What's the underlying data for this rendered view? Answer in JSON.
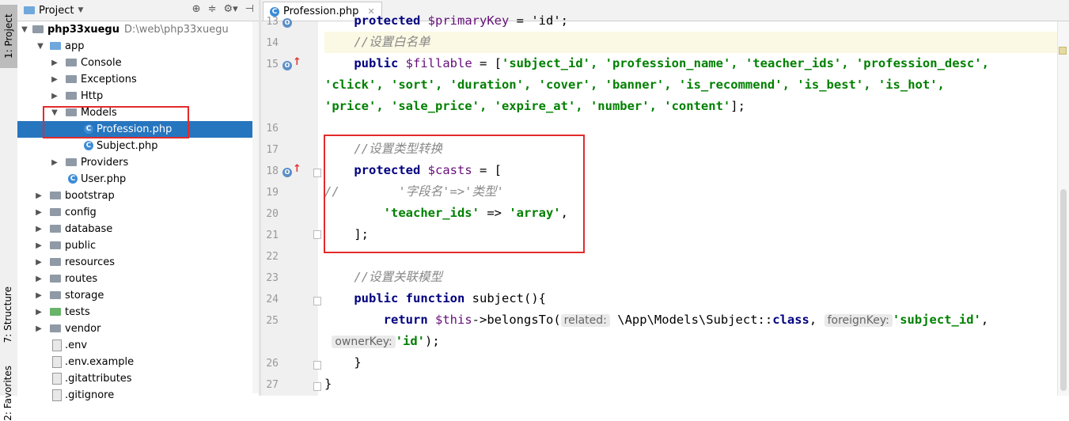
{
  "toolstrip": {
    "project_tab": "1: Project",
    "structure_tab": "7: Structure",
    "favorites_tab": "2: Favorites"
  },
  "project_panel": {
    "title": "Project",
    "root": {
      "name": "php33xuegu",
      "path": "D:\\web\\php33xuegu"
    },
    "tree": [
      {
        "label": "app"
      },
      {
        "label": "Console"
      },
      {
        "label": "Exceptions"
      },
      {
        "label": "Http"
      },
      {
        "label": "Models"
      },
      {
        "label": "Profession.php"
      },
      {
        "label": "Subject.php"
      },
      {
        "label": "Providers"
      },
      {
        "label": "User.php"
      },
      {
        "label": "bootstrap"
      },
      {
        "label": "config"
      },
      {
        "label": "database"
      },
      {
        "label": "public"
      },
      {
        "label": "resources"
      },
      {
        "label": "routes"
      },
      {
        "label": "storage"
      },
      {
        "label": "tests"
      },
      {
        "label": "vendor"
      },
      {
        "label": ".env"
      },
      {
        "label": ".env.example"
      },
      {
        "label": ".gitattributes"
      },
      {
        "label": ".gitignore"
      }
    ]
  },
  "editor": {
    "tab_label": "Profession.php",
    "line_numbers": [
      "13",
      "14",
      "15",
      "16",
      "17",
      "18",
      "19",
      "20",
      "21",
      "22",
      "23",
      "24",
      "25",
      "26",
      "27"
    ],
    "code": {
      "l13_kw": "protected",
      "l13_var": "$primaryKey",
      "l13_rest": " = 'id';",
      "l14": "//设置白名单",
      "l15_kw": "public",
      "l15_var": "$fillable",
      "l15_eq": " = [",
      "l15_a": "'subject_id', 'profession_name', 'teacher_ids', 'profession_desc',",
      "l15_b": "'click', 'sort', 'duration', 'cover', 'banner', 'is_recommend', 'is_best', 'is_hot',",
      "l15_c": "'price', 'sale_price', 'expire_at', 'number', 'content'",
      "l15_end": "];",
      "l17": "//设置类型转换",
      "l18_kw": "protected",
      "l18_var": "$casts",
      "l18_rest": " = [",
      "l19_gutter": "//",
      "l19": "'字段名'=>'类型'",
      "l20_str1": "'teacher_ids'",
      "l20_op": " => ",
      "l20_str2": "'array'",
      "l20_end": ",",
      "l21": "];",
      "l23": "//设置关联模型",
      "l24_kw1": "public",
      "l24_kw2": "function",
      "l24_rest": " subject(){",
      "l25_kw": "return",
      "l25_var": "$this",
      "l25_call": "->belongsTo(",
      "l25_hint1": "related:",
      "l25_arg1": "\\App\\Models\\Subject::",
      "l25_kw2": "class",
      "l25_comma": ",",
      "l25_hint2": "foreignKey:",
      "l25_str1": "'subject_id'",
      "l25_comma2": ",",
      "l25b_hint": "ownerKey:",
      "l25b_str": "'id'",
      "l25b_end": ");",
      "l26": "}",
      "l27": "}"
    }
  }
}
